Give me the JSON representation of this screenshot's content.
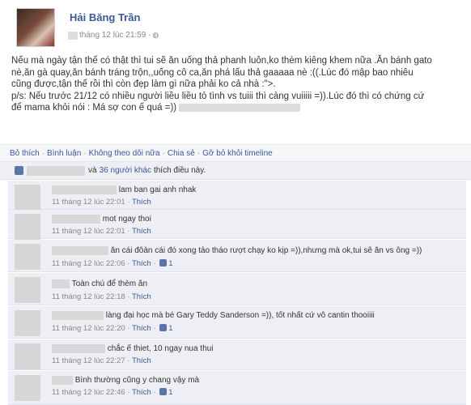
{
  "post": {
    "author": "Hải Băng Trần",
    "time": "tháng 12 lúc 21:59 ·",
    "body_line1": "Nếu mà ngày tận thế có thật thì tui sẽ ăn uống thả phanh luôn,ko thèm kiêng khem nữa .Ăn bánh gato",
    "body_line2": "nè,ăn gà quay,ăn bánh tráng trộn,,uống cô ca,ăn phá lấu thả gaaaaa nè :((.Lúc đó mập bao nhiêu",
    "body_line3": "cũng được,tận thế rồi thì còn đẹp làm gì nữa phải ko cả nhà :\">.",
    "body_line4": "p/s: Nếu trước 21/12 có nhiều người liều liều tỏ tình vs tuiii thì càng vuiiiii =)).Lúc đó thì có chứng cứ",
    "body_line5": "để mama khỏi nói : Má sợ con ế quá =))"
  },
  "actions": {
    "like": "Bỏ thích",
    "comment": "Bình luận",
    "unfollow": "Không theo dõi nữa",
    "share": "Chia sẻ",
    "remove": "Gỡ bỏ khỏi timeline",
    "sep": "·"
  },
  "likes": {
    "and": "và",
    "others": "36 người khác",
    "suffix": "thích điều này."
  },
  "comments": [
    {
      "text": "lam ban gai anh nhak",
      "time": "11 tháng 12 lúc 22:01",
      "like": "Thích",
      "count": ""
    },
    {
      "text": "mot ngay thoi",
      "time": "11 tháng 12 lúc 22:01",
      "like": "Thích",
      "count": ""
    },
    {
      "text": "ăn cái đôàn cái đó xong tảo tháo rượt chạy ko kịp =)),nhưng mà ok,tui sẽ ăn vs ông =))",
      "time": "11 tháng 12 lúc 22:06",
      "like": "Thích",
      "count": "1"
    },
    {
      "text": "Toàn chú để thèm ăn",
      "time": "11 tháng 12 lúc 22:18",
      "like": "Thích",
      "count": ""
    },
    {
      "text": "làng đại học mà bé Gary Teddy Sanderson =)), tốt nhất cứ vô cantin thooiiii",
      "time": "11 tháng 12 lúc 22:20",
      "like": "Thích",
      "count": "1"
    },
    {
      "text": "chắc ế thiet, 10 ngay nua thui",
      "time": "11 tháng 12 lúc 22:27",
      "like": "Thích",
      "count": ""
    },
    {
      "text": "Bình thường cũng y chang vậy mà",
      "time": "11 tháng 12 lúc 22:46",
      "like": "Thích",
      "count": "1"
    }
  ]
}
